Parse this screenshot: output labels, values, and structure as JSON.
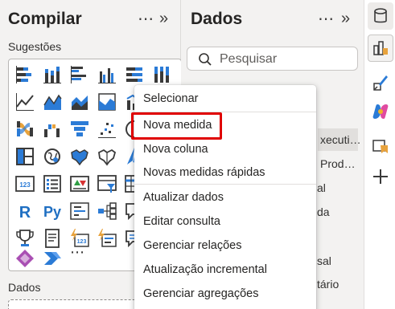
{
  "compilar": {
    "title": "Compilar",
    "more": "⋯",
    "collapse": "»",
    "suggestions_label": "Sugestões",
    "more_visuals": "⋯",
    "data_label": "Dados"
  },
  "visuals": [
    "stacked-bar-chart-icon",
    "stacked-column-chart-icon",
    "clustered-bar-chart-icon",
    "clustered-column-chart-icon",
    "100-stacked-bar-chart-icon",
    "100-stacked-column-chart-icon",
    "line-chart-icon",
    "area-chart-icon",
    "stacked-area-chart-icon",
    "100-stacked-area-chart-icon",
    "line-column-chart-icon",
    "ribbon-chart-icon",
    "waterfall-chart-icon",
    "funnel-chart-icon",
    "scatter-chart-icon",
    "pie-chart-icon",
    "treemap-icon",
    "map-icon",
    "filled-map-icon",
    "shape-map-icon",
    "azure-map-icon",
    "card-icon",
    "multi-row-card-icon",
    "kpi-icon",
    "slicer-icon",
    "table-icon",
    "r-visual-icon",
    "python-visual-icon",
    "key-influencers-icon",
    "decomposition-tree-icon",
    "qa-icon",
    "trophy-icon",
    "paginated-report-icon",
    "metrics-icon",
    "new-card-icon",
    "power-apps-icon",
    "power-automate-icon"
  ],
  "dados": {
    "title": "Dados",
    "more": "⋯",
    "collapse": "»",
    "search_placeholder": "Pesquisar",
    "tree_fragments": [
      "xecuti…",
      "Prod…",
      "al",
      "da",
      "sal",
      "tário"
    ]
  },
  "rail": [
    "database-icon",
    "build-visual-icon",
    "format-brush-icon",
    "copilot-icon",
    "bookmark-pane-icon",
    "add-pane-icon"
  ],
  "context_menu": {
    "items": [
      "Selecionar",
      "Nova medida",
      "Nova coluna",
      "Novas medidas rápidas",
      "Atualizar dados",
      "Editar consulta",
      "Gerenciar relações",
      "Atualização incremental",
      "Gerenciar agregações"
    ],
    "highlighted": "Nova medida",
    "highlight_color": "#e00000"
  }
}
